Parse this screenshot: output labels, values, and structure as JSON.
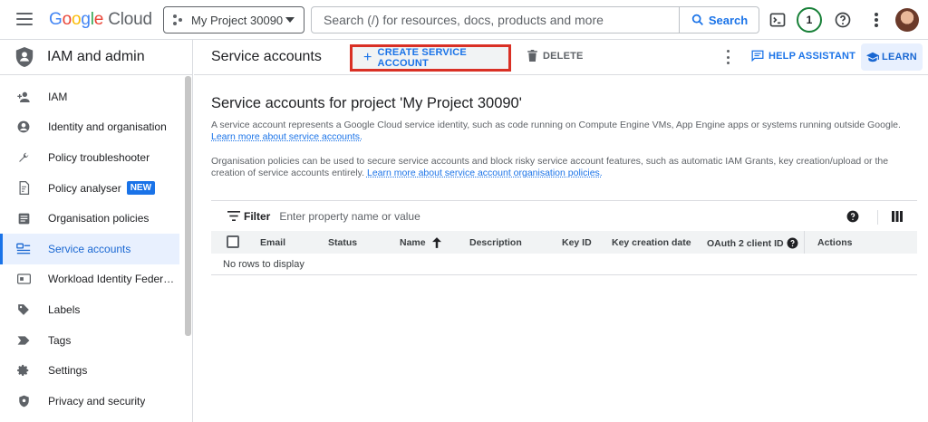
{
  "topbar": {
    "logo_parts": [
      "G",
      "o",
      "o",
      "g",
      "l",
      "e"
    ],
    "logo_cloud": "Cloud",
    "project_name": "My Project 30090",
    "search_placeholder": "Search (/) for resources, docs, products and more",
    "search_button": "Search",
    "notifications_count": "1"
  },
  "sidebar": {
    "title": "IAM and admin",
    "items": [
      {
        "label": "IAM",
        "icon": "person-add-icon"
      },
      {
        "label": "Identity and organisation",
        "icon": "account-circle-icon"
      },
      {
        "label": "Policy troubleshooter",
        "icon": "wrench-icon"
      },
      {
        "label": "Policy analyser",
        "icon": "document-search-icon",
        "badge": "NEW"
      },
      {
        "label": "Organisation policies",
        "icon": "article-icon"
      },
      {
        "label": "Service accounts",
        "icon": "service-account-icon",
        "active": true
      },
      {
        "label": "Workload Identity Federat...",
        "icon": "id-card-icon"
      },
      {
        "label": "Labels",
        "icon": "label-icon"
      },
      {
        "label": "Tags",
        "icon": "tag-icon"
      },
      {
        "label": "Settings",
        "icon": "gear-icon"
      },
      {
        "label": "Privacy and security",
        "icon": "shield-icon"
      }
    ]
  },
  "header": {
    "title": "Service accounts",
    "create_label": "CREATE SERVICE ACCOUNT",
    "delete_label": "DELETE",
    "help_label": "HELP ASSISTANT",
    "learn_label": "LEARN"
  },
  "content": {
    "heading": "Service accounts for project 'My Project 30090'",
    "para1_text": "A service account represents a Google Cloud service identity, such as code running on Compute Engine VMs, App Engine apps or systems running outside Google.",
    "para1_link": "Learn more about service accounts.",
    "para2_text": "Organisation policies can be used to secure service accounts and block risky service account features, such as automatic IAM Grants, key creation/upload or the creation of service accounts entirely.",
    "para2_link": "Learn more about service account organisation policies."
  },
  "table": {
    "filter_label": "Filter",
    "filter_placeholder": "Enter property name or value",
    "columns": [
      "Email",
      "Status",
      "Name",
      "Description",
      "Key ID",
      "Key creation date",
      "OAuth 2 client ID",
      "Actions"
    ],
    "empty_text": "No rows to display"
  },
  "colors": {
    "accent": "#1a73e8",
    "highlight_border": "#d93025",
    "active_bg": "#e8f0fe"
  }
}
